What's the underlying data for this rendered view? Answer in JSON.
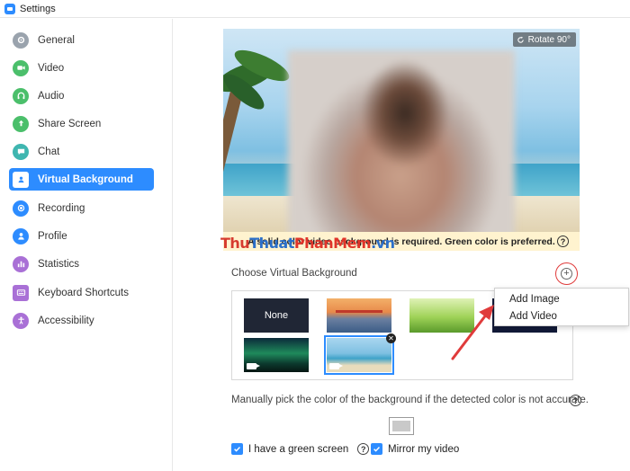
{
  "window": {
    "title": "Settings"
  },
  "sidebar": {
    "items": [
      {
        "label": "General",
        "icon": "gear-icon",
        "color": "#9aa3ad"
      },
      {
        "label": "Video",
        "icon": "video-icon",
        "color": "#4bbf6b"
      },
      {
        "label": "Audio",
        "icon": "headphones-icon",
        "color": "#4bbf6b"
      },
      {
        "label": "Share Screen",
        "icon": "share-screen-icon",
        "color": "#4bbf6b"
      },
      {
        "label": "Chat",
        "icon": "chat-icon",
        "color": "#3fb6b0"
      },
      {
        "label": "Virtual Background",
        "icon": "person-card-icon",
        "color": "#2d8cff",
        "active": true
      },
      {
        "label": "Recording",
        "icon": "record-icon",
        "color": "#2d8cff"
      },
      {
        "label": "Profile",
        "icon": "profile-icon",
        "color": "#2d8cff"
      },
      {
        "label": "Statistics",
        "icon": "statistics-icon",
        "color": "#a970d6"
      },
      {
        "label": "Keyboard Shortcuts",
        "icon": "keyboard-icon",
        "color": "#a970d6"
      },
      {
        "label": "Accessibility",
        "icon": "accessibility-icon",
        "color": "#a970d6"
      }
    ]
  },
  "preview": {
    "rotate_label": "Rotate 90°",
    "notice": "A solid color video background is required. Green color is preferred."
  },
  "watermark": {
    "part1": "Thu",
    "part2": "Thuat",
    "part3": "PhanMem",
    "part4": ".vn"
  },
  "choose": {
    "label": "Choose Virtual Background",
    "add_symbol": "+"
  },
  "backgrounds": [
    {
      "name": "None",
      "type": "none"
    },
    {
      "name": "Golden Gate",
      "type": "image"
    },
    {
      "name": "Grass",
      "type": "image"
    },
    {
      "name": "Space",
      "type": "image"
    },
    {
      "name": "Aurora",
      "type": "video"
    },
    {
      "name": "Beach",
      "type": "video",
      "selected": true
    }
  ],
  "dropdown": {
    "add_image": "Add Image",
    "add_video": "Add Video"
  },
  "manual": {
    "text": "Manually pick the color of the background if the detected color is not accurate."
  },
  "checkboxes": {
    "green_screen": {
      "label": "I have a green screen",
      "checked": true
    },
    "mirror": {
      "label": "Mirror my video",
      "checked": true
    }
  },
  "colors": {
    "accent": "#2d8cff",
    "highlight": "#e03b3b",
    "notice_bg": "#fff3cf"
  }
}
